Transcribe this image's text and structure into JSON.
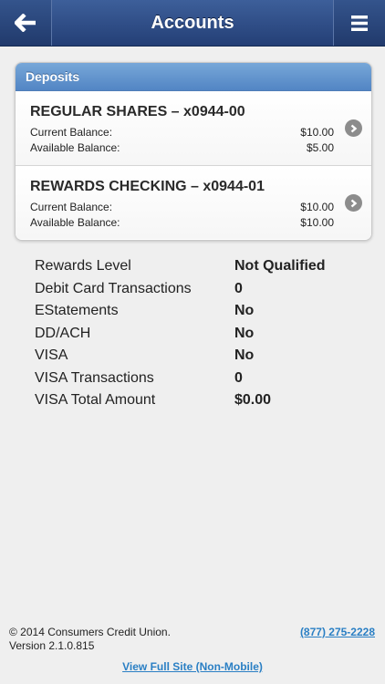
{
  "header": {
    "title": "Accounts",
    "back_icon": "arrow-left-icon",
    "menu_icon": "hamburger-menu-icon",
    "bar_color": "#2e4c86"
  },
  "deposits": {
    "heading": "Deposits",
    "heading_color": "#5f93cd",
    "accounts": [
      {
        "name": "REGULAR SHARES – x0944-00",
        "current_label": "Current Balance:",
        "current_value": "$10.00",
        "available_label": "Available Balance:",
        "available_value": "$5.00"
      },
      {
        "name": "REWARDS CHECKING – x0944-01",
        "current_label": "Current Balance:",
        "current_value": "$10.00",
        "available_label": "Available Balance:",
        "available_value": "$10.00"
      }
    ]
  },
  "rewards": [
    {
      "label": "Rewards Level",
      "value": "Not Qualified"
    },
    {
      "label": "Debit Card Transactions",
      "value": "0"
    },
    {
      "label": "EStatements",
      "value": "No"
    },
    {
      "label": "DD/ACH",
      "value": "No"
    },
    {
      "label": "VISA",
      "value": "No"
    },
    {
      "label": "VISA Transactions",
      "value": "0"
    },
    {
      "label": "VISA Total Amount",
      "value": "$0.00"
    }
  ],
  "footer": {
    "copyright": "© 2014 Consumers Credit Union.",
    "version": "Version 2.1.0.815",
    "phone": "(877) 275-2228",
    "full_site": "View Full Site (Non-Mobile)",
    "link_color": "#2a7fc4"
  }
}
